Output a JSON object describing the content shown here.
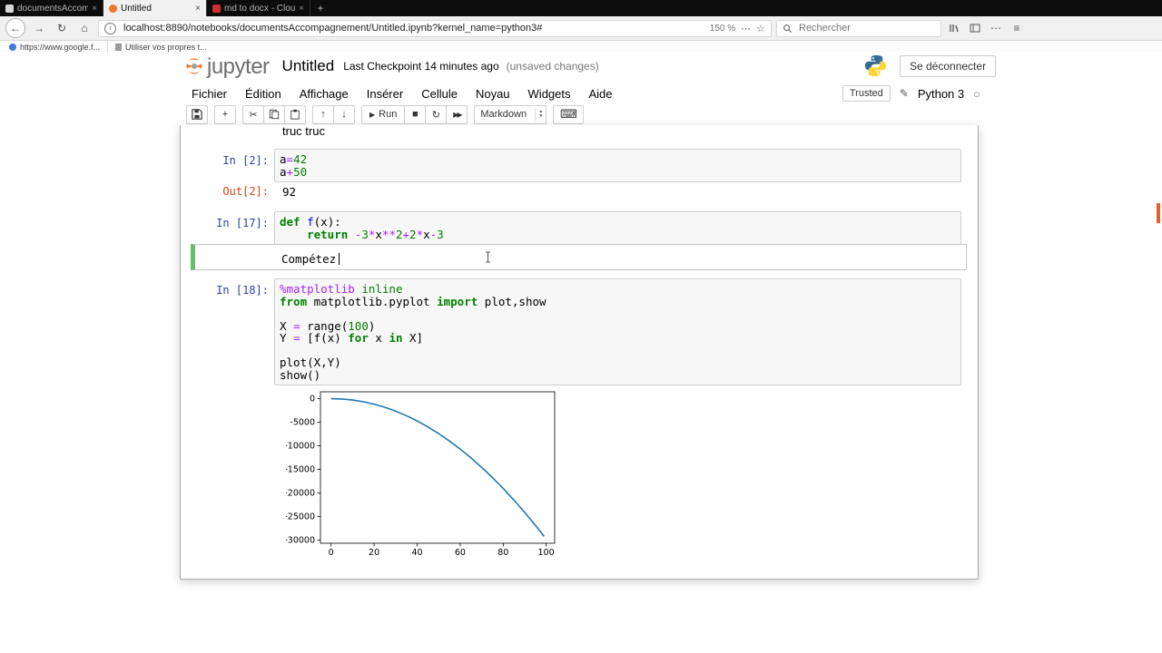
{
  "browser": {
    "tabs": [
      {
        "title": "documentsAccompagn...",
        "active": false
      },
      {
        "title": "Untitled",
        "active": true
      },
      {
        "title": "md to docx - CloudConv...",
        "active": false
      }
    ],
    "url": "localhost:8890/notebooks/documentsAccompagnement/Untitled.ipynb?kernel_name=python3#",
    "zoom": "150 %",
    "search_placeholder": "Rechercher",
    "bookmarks": [
      {
        "label": "https://www.google.f..."
      },
      {
        "label": "Utiliser vos propres t..."
      }
    ]
  },
  "icons": {
    "close": "×",
    "plus": "+",
    "back": "←",
    "forward": "→",
    "reload": "↻",
    "home": "⌂",
    "dots": "⋯",
    "star": "☆",
    "menu": "≡",
    "cut": "✂",
    "up": "↑",
    "down": "↓",
    "play": "▶",
    "stop": "■",
    "restart": "↻",
    "ff": "▶▶",
    "keyboard": "⌨",
    "pencil": "✎",
    "kernel_idle": "○",
    "sel_up": "▲",
    "sel_down": "▼",
    "info": "i"
  },
  "header": {
    "logo_text": "jupyter",
    "title": "Untitled",
    "checkpoint": "Last Checkpoint 14 minutes ago",
    "status": "(unsaved changes)",
    "logout_label": "Se déconnecter"
  },
  "menu": {
    "items": [
      "Fichier",
      "Édition",
      "Affichage",
      "Insérer",
      "Cellule",
      "Noyau",
      "Widgets",
      "Aide"
    ],
    "trusted_label": "Trusted",
    "kernel_name": "Python 3"
  },
  "toolbar": {
    "run_label": "Run",
    "cell_type": "Markdown"
  },
  "notebook": {
    "clipped_markdown": "truc truc",
    "in2": {
      "prompt": "In [2]:",
      "lines": [
        [
          {
            "t": "a"
          },
          {
            "t": "=",
            "c": "op"
          },
          {
            "t": "42",
            "c": "num"
          }
        ],
        [
          {
            "t": "a"
          },
          {
            "t": "+",
            "c": "op"
          },
          {
            "t": "50",
            "c": "num"
          }
        ]
      ]
    },
    "out2": {
      "prompt": "Out[2]:",
      "value": "92"
    },
    "in17": {
      "prompt": "In [17]:",
      "lines": [
        [
          {
            "t": "def",
            "c": "kw"
          },
          {
            "t": " "
          },
          {
            "t": "f",
            "c": "fn"
          },
          {
            "t": "(x):"
          }
        ],
        [
          {
            "t": "    "
          },
          {
            "t": "return",
            "c": "kw"
          },
          {
            "t": " "
          },
          {
            "t": "-",
            "c": "op"
          },
          {
            "t": "3",
            "c": "num"
          },
          {
            "t": "*",
            "c": "op"
          },
          {
            "t": "x"
          },
          {
            "t": "**",
            "c": "op"
          },
          {
            "t": "2",
            "c": "num"
          },
          {
            "t": "+",
            "c": "op"
          },
          {
            "t": "2",
            "c": "num"
          },
          {
            "t": "*",
            "c": "op"
          },
          {
            "t": "x"
          },
          {
            "t": "-",
            "c": "op"
          },
          {
            "t": "3",
            "c": "num"
          }
        ]
      ]
    },
    "md_edit": {
      "text": "Compétez"
    },
    "in18": {
      "prompt": "In [18]:",
      "lines": [
        [
          {
            "t": "%matplotlib",
            "c": "mg"
          },
          {
            "t": " "
          },
          {
            "t": "inline",
            "c": "num"
          }
        ],
        [
          {
            "t": "from",
            "c": "kw"
          },
          {
            "t": " matplotlib.pyplot "
          },
          {
            "t": "import",
            "c": "kw"
          },
          {
            "t": " plot,show"
          }
        ],
        [],
        [
          {
            "t": "X "
          },
          {
            "t": "=",
            "c": "op"
          },
          {
            "t": " range("
          },
          {
            "t": "100",
            "c": "num"
          },
          {
            "t": ")"
          }
        ],
        [
          {
            "t": "Y "
          },
          {
            "t": "=",
            "c": "op"
          },
          {
            "t": " [f(x) "
          },
          {
            "t": "for",
            "c": "kw"
          },
          {
            "t": " x "
          },
          {
            "t": "in",
            "c": "kw"
          },
          {
            "t": " X]"
          }
        ],
        [],
        [
          {
            "t": "plot(X,Y)"
          }
        ],
        [
          {
            "t": "show()"
          }
        ]
      ]
    }
  },
  "chart_data": {
    "type": "line",
    "title": "",
    "xlabel": "",
    "ylabel": "",
    "x": [
      0,
      5,
      10,
      15,
      20,
      25,
      30,
      35,
      40,
      45,
      50,
      55,
      60,
      65,
      70,
      75,
      80,
      85,
      90,
      95,
      99
    ],
    "y": [
      -3,
      -68,
      -283,
      -648,
      -1163,
      -1828,
      -2643,
      -3608,
      -4723,
      -5988,
      -7403,
      -8968,
      -10683,
      -12548,
      -14563,
      -16728,
      -19043,
      -21508,
      -24123,
      -26888,
      -29208
    ],
    "xlim": [
      -4.95,
      103.95
    ],
    "ylim": [
      -30670,
      1460
    ],
    "xticks": [
      0,
      20,
      40,
      60,
      80,
      100
    ],
    "yticks": [
      0,
      -5000,
      -10000,
      -15000,
      -20000,
      -25000,
      -30000
    ],
    "line_color": "#1f77b4",
    "grid": false,
    "legend_position": "none"
  }
}
